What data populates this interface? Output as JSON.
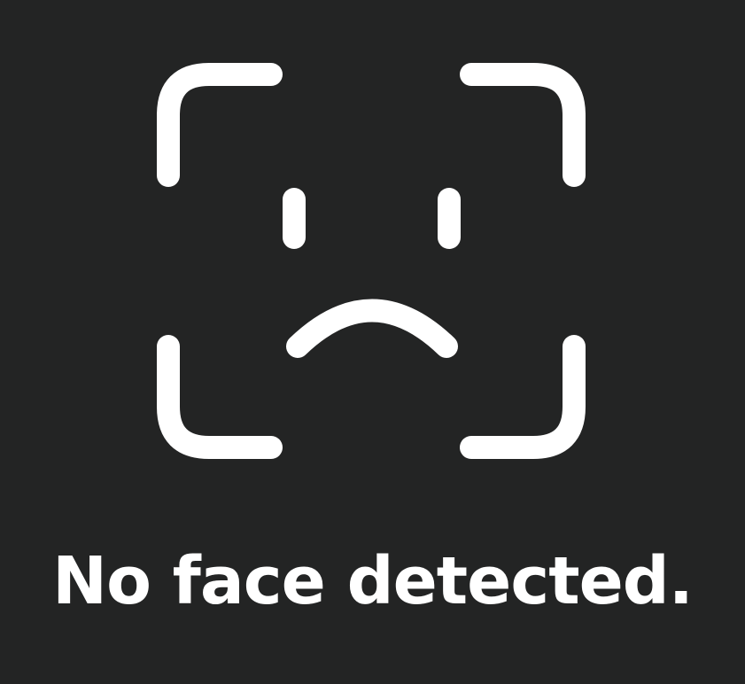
{
  "status": {
    "message": "No face detected."
  },
  "glyph": {
    "icon": "face-id-sad-icon",
    "color": "#FFFFFF"
  },
  "theme": {
    "background": "#232424"
  }
}
